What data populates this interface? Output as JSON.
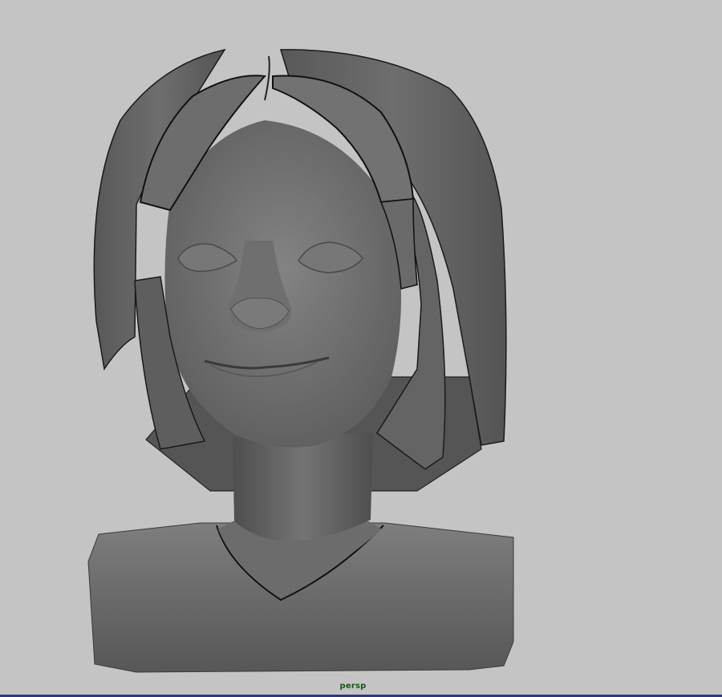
{
  "viewport": {
    "camera_label": "persp",
    "background_color": "#c4c4c4",
    "label_color": "#0f5a14"
  },
  "model": {
    "icon": "female-head-bust-model",
    "shading": "smooth-shaded-gray"
  }
}
